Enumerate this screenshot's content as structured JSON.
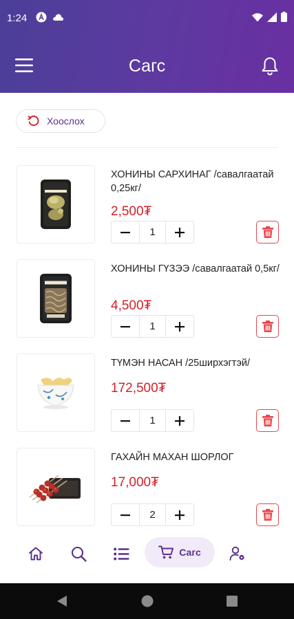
{
  "status_bar": {
    "time": "1:24"
  },
  "header": {
    "title": "Сагс"
  },
  "clear_button": {
    "label": "Хоослох"
  },
  "cart_items": [
    {
      "name": "ХОНИНЫ САРХИНАГ /савалгаатай 0,25кг/",
      "price": "2,500₮",
      "quantity": "1"
    },
    {
      "name": "ХОНИНЫ ГҮЗЭЭ /савалгаатай 0,5кг/",
      "price": "4,500₮",
      "quantity": "1"
    },
    {
      "name": "ТҮМЭН НАСАН /25ширхэгтэй/",
      "price": "172,500₮",
      "quantity": "1"
    },
    {
      "name": "ГАХАЙН МАХАН ШОРЛОГ",
      "price": "17,000₮",
      "quantity": "2"
    }
  ],
  "bottom_nav": {
    "cart_label": "Сагс"
  },
  "colors": {
    "brand": "#5c3aa0",
    "price": "#d32027",
    "delete": "#e8464c"
  }
}
